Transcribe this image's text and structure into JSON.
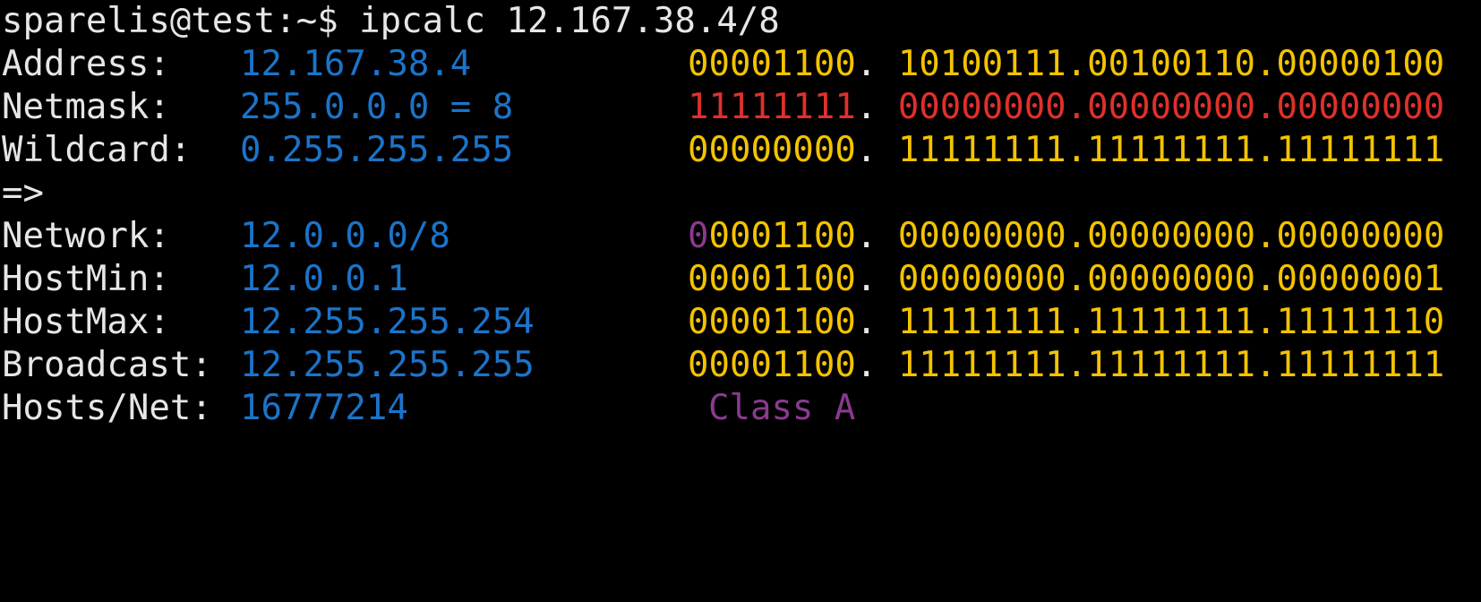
{
  "colors": {
    "background": "#000000",
    "label": "#e6e6e6",
    "value": "#1b74c9",
    "binary_default": "#f3c300",
    "netmask_bits": "#e0302c",
    "class_bit": "#8a3a8f"
  },
  "prompt": {
    "text": "sparelis@test:~$ ipcalc 12.167.38.4/8"
  },
  "rows": {
    "address": {
      "label": "Address:",
      "value": "12.167.38.4",
      "bin_first": "00001100",
      "bin_sep": ". ",
      "bin_rest": "10100111.00100110.00000100"
    },
    "netmask": {
      "label": "Netmask:",
      "value": "255.0.0.0 = 8",
      "bin_first": "11111111",
      "bin_sep": ". ",
      "bin_rest": "00000000.00000000.00000000"
    },
    "wildcard": {
      "label": "Wildcard:",
      "value": "0.255.255.255",
      "bin_first": "00000000",
      "bin_sep": ". ",
      "bin_rest": "11111111.11111111.11111111"
    },
    "arrow": {
      "text": "=>"
    },
    "network": {
      "label": "Network:",
      "value": "12.0.0.0/8",
      "class_bit": "0",
      "bin_first": "0001100",
      "bin_sep": ". ",
      "bin_rest": "00000000.00000000.00000000"
    },
    "hostmin": {
      "label": "HostMin:",
      "value": "12.0.0.1",
      "bin_first": "00001100",
      "bin_sep": ". ",
      "bin_rest": "00000000.00000000.00000001"
    },
    "hostmax": {
      "label": "HostMax:",
      "value": "12.255.255.254",
      "bin_first": "00001100",
      "bin_sep": ". ",
      "bin_rest": "11111111.11111111.11111110"
    },
    "broadcast": {
      "label": "Broadcast:",
      "value": "12.255.255.255",
      "bin_first": "00001100",
      "bin_sep": ". ",
      "bin_rest": "11111111.11111111.11111111"
    },
    "hosts": {
      "label": "Hosts/Net:",
      "value": "16777214",
      "class": "Class A"
    }
  }
}
